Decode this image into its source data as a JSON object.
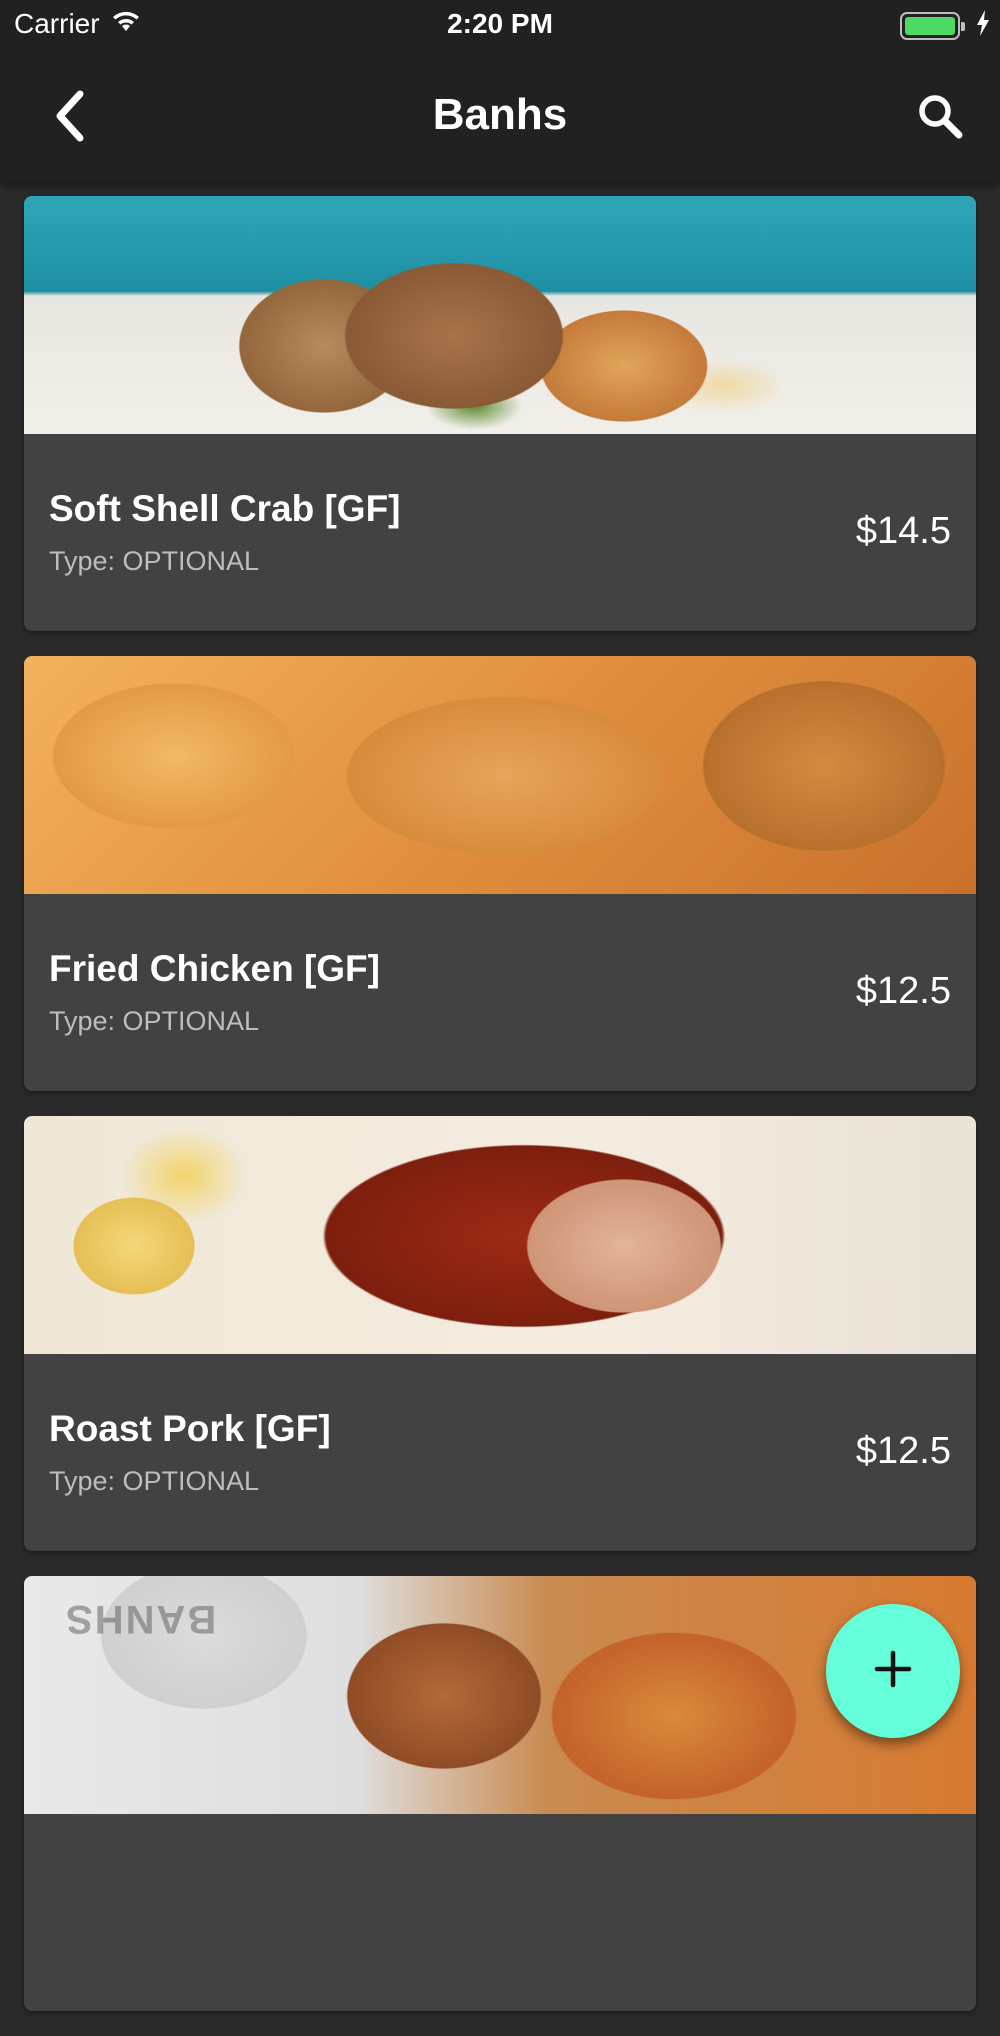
{
  "status_bar": {
    "carrier": "Carrier",
    "time": "2:20 PM",
    "battery_color": "#4cd964"
  },
  "nav": {
    "back_icon": "chevron-left-icon",
    "title": "Banhs",
    "search_icon": "search-icon"
  },
  "items": [
    {
      "name": "Soft Shell Crab [GF]",
      "type": "Type: OPTIONAL",
      "price": "$14.5",
      "image": "soft-shell-crab-photo"
    },
    {
      "name": "Fried Chicken [GF]",
      "type": "Type: OPTIONAL",
      "price": "$12.5",
      "image": "fried-chicken-photo"
    },
    {
      "name": "Roast Pork [GF]",
      "type": "Type: OPTIONAL",
      "price": "$12.5",
      "image": "roast-pork-photo"
    },
    {
      "image": "banh-mi-photo",
      "image_text": "BANHS"
    }
  ],
  "fab": {
    "icon": "plus-icon",
    "color": "#64ffda"
  },
  "colors": {
    "background": "#2a2a2a",
    "app_bar": "#212121",
    "card": "#424242",
    "secondary_text": "#bdbdbd"
  }
}
